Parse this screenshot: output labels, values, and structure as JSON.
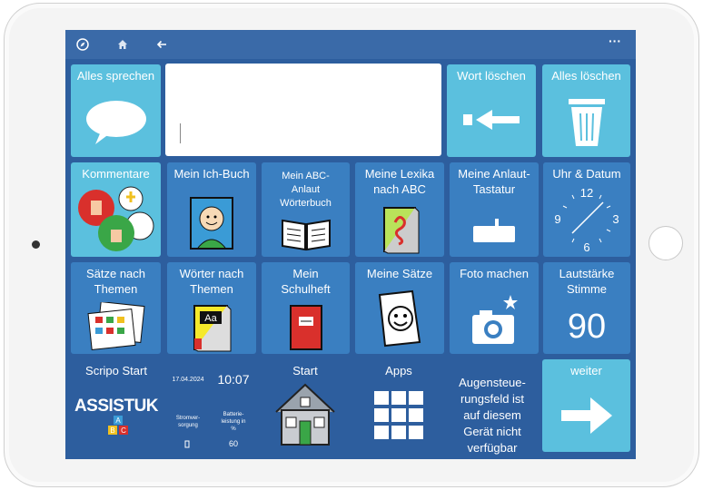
{
  "topbar": {
    "compass_icon": "compass-icon",
    "home_icon": "home-icon",
    "back_icon": "arrow-left-icon",
    "more": "···"
  },
  "row1": {
    "speak_all": "Alles sprechen",
    "delete_word": "Wort löschen",
    "delete_all": "Alles löschen"
  },
  "row2": [
    {
      "label": "Kommentare"
    },
    {
      "label": "Mein Ich-Buch"
    },
    {
      "label": "Mein ABC-\nAnlaut\nWörterbuch"
    },
    {
      "label": "Meine Lexika\nnach ABC"
    },
    {
      "label": "Meine Anlaut-\nTastatur"
    },
    {
      "label": "Uhr & Datum"
    }
  ],
  "clock": {
    "n12": "12",
    "n3": "3",
    "n6": "6",
    "n9": "9"
  },
  "row3": [
    {
      "label": "Sätze nach\nThemen"
    },
    {
      "label": "Wörter nach\nThemen"
    },
    {
      "label": "Mein\nSchulheft"
    },
    {
      "label": "Meine Sätze"
    },
    {
      "label": "Foto machen"
    },
    {
      "label": "Lautstärke\nStimme"
    }
  ],
  "volume_value": "90",
  "abc_letters": {
    "a": "A",
    "b": "B",
    "c": "C"
  },
  "book_label": "Aa",
  "bottom": {
    "scripo_start": "Scripo Start",
    "logo": "ASSISTUK",
    "date": "17.04.2024",
    "time": "10:07",
    "power_label": "Stromver-\nsorgung",
    "battery_label": "Batterie-\nleistung in\n%",
    "battery_value": "60",
    "start": "Start",
    "apps": "Apps",
    "eye_notice": "Augensteue-\nrungsfeld ist\nauf diesem\nGerät nicht\nverfügbar",
    "next": "weiter"
  }
}
